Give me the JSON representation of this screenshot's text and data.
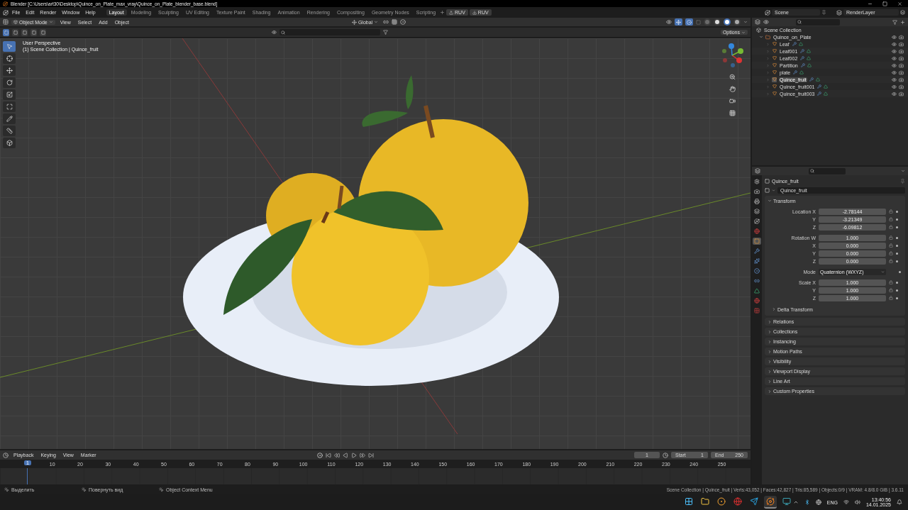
{
  "window": {
    "title": "Blender [C:\\Users\\art30\\Desktop\\Quince_on_Plate_max_vray\\Quince_on_Plate_blender_base.blend]"
  },
  "menu": [
    "File",
    "Edit",
    "Render",
    "Window",
    "Help"
  ],
  "workspaces": [
    {
      "label": "Layout",
      "selected": true
    },
    {
      "label": "Modeling",
      "selected": false
    },
    {
      "label": "Sculpting",
      "selected": false
    },
    {
      "label": "UV Editing",
      "selected": false
    },
    {
      "label": "Texture Paint",
      "selected": false
    },
    {
      "label": "Shading",
      "selected": false
    },
    {
      "label": "Animation",
      "selected": false
    },
    {
      "label": "Rendering",
      "selected": false
    },
    {
      "label": "Compositing",
      "selected": false
    },
    {
      "label": "Geometry Nodes",
      "selected": false
    },
    {
      "label": "Scripting",
      "selected": false
    }
  ],
  "ruv_buttons": [
    {
      "kind": "upload",
      "label": "RUV"
    },
    {
      "kind": "download",
      "label": "RUV"
    }
  ],
  "scene": {
    "name": "Scene",
    "view_layer": "RenderLayer"
  },
  "viewport": {
    "mode": "Object Mode",
    "menus": [
      "View",
      "Select",
      "Add",
      "Object"
    ],
    "orientation": "Global",
    "options": "Options",
    "overlay": [
      "User Perspective",
      "(1) Scene Collection | Quince_fruit"
    ],
    "select_modes": [
      {
        "selected": true
      },
      {
        "selected": false
      },
      {
        "selected": false
      },
      {
        "selected": false
      },
      {
        "selected": false
      }
    ],
    "shading_modes": [
      {
        "kind": "wireframe",
        "selected": false
      },
      {
        "kind": "solid",
        "selected": false
      },
      {
        "kind": "material",
        "selected": true
      },
      {
        "kind": "rendered",
        "selected": false
      }
    ],
    "tools": [
      {
        "kind": "select",
        "selected": true
      },
      {
        "kind": "cursor",
        "selected": false
      },
      {
        "kind": "move",
        "selected": false
      },
      {
        "kind": "rotate",
        "selected": false
      },
      {
        "kind": "scale",
        "selected": false
      },
      {
        "kind": "transform",
        "selected": false
      },
      {
        "kind": "annotate",
        "selected": false
      },
      {
        "kind": "measure",
        "selected": false
      },
      {
        "kind": "add",
        "selected": false
      }
    ]
  },
  "outliner": {
    "root": "Scene Collection",
    "collections": [
      {
        "name": "Quince_on_Plate",
        "expanded": true,
        "children": [
          {
            "name": "Leaf",
            "selected": false
          },
          {
            "name": "Leaf001",
            "selected": false
          },
          {
            "name": "Leaf002",
            "selected": false
          },
          {
            "name": "Partition",
            "selected": false
          },
          {
            "name": "plate",
            "selected": false
          },
          {
            "name": "Quince_fruit",
            "selected": true
          },
          {
            "name": "Quince_fruit001",
            "selected": false
          },
          {
            "name": "Quince_fruit003",
            "selected": false
          }
        ]
      }
    ]
  },
  "properties": {
    "tabs": [
      {
        "kind": "tool",
        "selected": false
      },
      {
        "kind": "render",
        "selected": false
      },
      {
        "kind": "output",
        "selected": false
      },
      {
        "kind": "view_layer",
        "selected": false
      },
      {
        "kind": "scene",
        "selected": false
      },
      {
        "kind": "world",
        "selected": false
      },
      {
        "kind": "object",
        "selected": true
      },
      {
        "kind": "modifier",
        "selected": false
      },
      {
        "kind": "particles",
        "selected": false
      },
      {
        "kind": "physics",
        "selected": false
      },
      {
        "kind": "constraints",
        "selected": false
      },
      {
        "kind": "data",
        "selected": false
      },
      {
        "kind": "material",
        "selected": false
      },
      {
        "kind": "texture",
        "selected": false
      }
    ],
    "object": "Quince_fruit",
    "datablock": "Quince_fruit",
    "transform": {
      "title": "Transform",
      "expanded": true,
      "groups": [
        [
          {
            "kind": "number",
            "label": "Location X",
            "value": "-2.78144"
          },
          {
            "kind": "number",
            "label": "Y",
            "value": "-3.21349"
          },
          {
            "kind": "number",
            "label": "Z",
            "value": "-6.09812"
          }
        ],
        [
          {
            "kind": "number",
            "label": "Rotation W",
            "value": "1.000"
          },
          {
            "kind": "number",
            "label": "X",
            "value": "0.000"
          },
          {
            "kind": "number",
            "label": "Y",
            "value": "0.000"
          },
          {
            "kind": "number",
            "label": "Z",
            "value": "0.000"
          }
        ],
        [
          {
            "kind": "dropdown",
            "label": "Mode",
            "value": "Quaternion (WXYZ)"
          }
        ],
        [
          {
            "kind": "number",
            "label": "Scale X",
            "value": "1.000"
          },
          {
            "kind": "number",
            "label": "Y",
            "value": "1.000"
          },
          {
            "kind": "number",
            "label": "Z",
            "value": "1.000"
          }
        ]
      ],
      "subpanel": {
        "title": "Delta Transform",
        "expanded": false
      }
    },
    "panels": [
      {
        "title": "Relations",
        "expanded": false
      },
      {
        "title": "Collections",
        "expanded": false
      },
      {
        "title": "Instancing",
        "expanded": false
      },
      {
        "title": "Motion Paths",
        "expanded": false
      },
      {
        "title": "Visibility",
        "expanded": false
      },
      {
        "title": "Viewport Display",
        "expanded": false
      },
      {
        "title": "Line Art",
        "expanded": false
      },
      {
        "title": "Custom Properties",
        "expanded": false
      }
    ]
  },
  "timeline": {
    "menus": [
      "Playback",
      "Keying",
      "View",
      "Marker"
    ],
    "current_frame": "1",
    "start": {
      "label": "Start",
      "value": "1"
    },
    "end": {
      "label": "End",
      "value": "250"
    },
    "playhead": "1",
    "ticks": [
      "10",
      "20",
      "30",
      "40",
      "50",
      "60",
      "70",
      "80",
      "90",
      "100",
      "110",
      "120",
      "130",
      "140",
      "150",
      "160",
      "170",
      "180",
      "190",
      "200",
      "210",
      "220",
      "230",
      "240",
      "250"
    ]
  },
  "status_bar": {
    "hints": [
      "Выделить",
      "Повернуть вид",
      "Object Context Menu"
    ],
    "stats": "Scene Collection | Quince_fruit | Verts:43,052 | Faces:42,827 | Tris:85,589 | Objects:0/9 | VRAM: 4.8/8.0 GiB | 3.6.11"
  },
  "taskbar": {
    "apps": [
      {
        "kind": "start",
        "selected": false
      },
      {
        "kind": "folder",
        "selected": false
      },
      {
        "kind": "target",
        "selected": false
      },
      {
        "kind": "browser",
        "selected": false
      },
      {
        "kind": "messenger",
        "selected": false
      },
      {
        "kind": "blender",
        "selected": true
      },
      {
        "kind": "app",
        "selected": false
      }
    ],
    "language": "ENG",
    "time": "13:40:56",
    "date": "14.01.2025"
  }
}
